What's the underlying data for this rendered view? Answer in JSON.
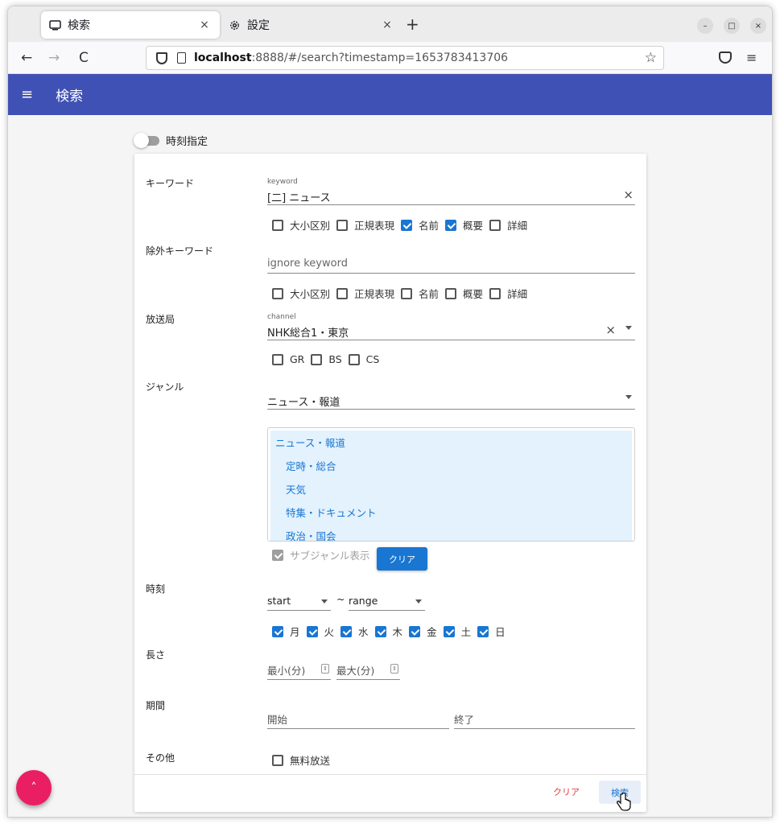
{
  "browser": {
    "tabs": [
      {
        "title": "検索",
        "icon": "monitor-icon",
        "close": "×"
      },
      {
        "title": "設定",
        "icon": "gear-icon",
        "close": "×"
      }
    ],
    "new_tab": "+",
    "window_controls": {
      "minimize": "–",
      "maximize": "□",
      "close": "×"
    },
    "nav": {
      "back": "←",
      "forward": "→",
      "reload": "C"
    },
    "url": {
      "host": "localhost",
      "rest": ":8888/#/search?timestamp=1653783413706"
    },
    "bookmark_star": "☆",
    "menu": "≡"
  },
  "appbar": {
    "menu": "≡",
    "title": "検索"
  },
  "time_toggle": {
    "label": "時刻指定",
    "on": false
  },
  "form": {
    "keyword": {
      "label": "キーワード",
      "field_label": "keyword",
      "value": "[二] ニュース",
      "clear": "×",
      "options": [
        {
          "label": "大小区別",
          "checked": false
        },
        {
          "label": "正規表現",
          "checked": false
        },
        {
          "label": "名前",
          "checked": true
        },
        {
          "label": "概要",
          "checked": true
        },
        {
          "label": "詳細",
          "checked": false
        }
      ]
    },
    "ignore_keyword": {
      "label": "除外キーワード",
      "placeholder": "ignore keyword",
      "options": [
        {
          "label": "大小区別",
          "checked": false
        },
        {
          "label": "正規表現",
          "checked": false
        },
        {
          "label": "名前",
          "checked": false
        },
        {
          "label": "概要",
          "checked": false
        },
        {
          "label": "詳細",
          "checked": false
        }
      ]
    },
    "channel": {
      "label": "放送局",
      "field_label": "channel",
      "value": "NHK総合1・東京",
      "clear": "×",
      "types": [
        {
          "label": "GR",
          "checked": false
        },
        {
          "label": "BS",
          "checked": false
        },
        {
          "label": "CS",
          "checked": false
        }
      ]
    },
    "genre": {
      "label": "ジャンル",
      "value": "ニュース・報道",
      "list": [
        {
          "label": "ニュース・報道",
          "level": "parent"
        },
        {
          "label": "定時・総合",
          "level": "child"
        },
        {
          "label": "天気",
          "level": "child"
        },
        {
          "label": "特集・ドキュメント",
          "level": "child"
        },
        {
          "label": "政治・国会",
          "level": "child"
        }
      ],
      "subgenre_label": "サブジャンル表示",
      "subgenre_checked": true,
      "clear_button": "クリア"
    },
    "time": {
      "label": "時刻",
      "start": "start",
      "tilde": "~",
      "range": "range",
      "days": [
        {
          "label": "月",
          "checked": true
        },
        {
          "label": "火",
          "checked": true
        },
        {
          "label": "水",
          "checked": true
        },
        {
          "label": "木",
          "checked": true
        },
        {
          "label": "金",
          "checked": true
        },
        {
          "label": "土",
          "checked": true
        },
        {
          "label": "日",
          "checked": true
        }
      ]
    },
    "length": {
      "label": "長さ",
      "min_placeholder": "最小(分)",
      "max_placeholder": "最大(分)"
    },
    "period": {
      "label": "期間",
      "start_placeholder": "開始",
      "end_placeholder": "終了"
    },
    "other": {
      "label": "その他",
      "free_label": "無料放送",
      "free_checked": false
    },
    "footer": {
      "clear": "クリア",
      "search": "検索"
    }
  },
  "fab": {
    "icon": "chevron-up-icon",
    "glyph": "˄"
  },
  "colors": {
    "appbar": "#3f51b5",
    "primary": "#1976d2",
    "fab": "#e91e63",
    "clear_text": "#e53935"
  }
}
